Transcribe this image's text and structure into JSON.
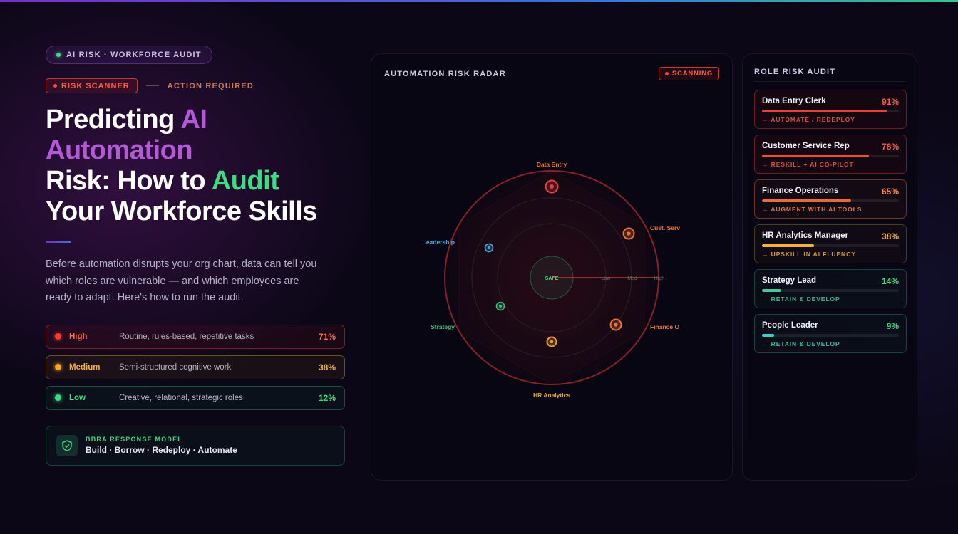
{
  "hero": {
    "pill": "AI RISK · WORKFORCE AUDIT",
    "scanner_tag": "RISK SCANNER",
    "action_label": "ACTION REQUIRED",
    "headline": {
      "part1": "Predicting ",
      "part2": "AI Automation",
      "part3": "Risk: How to ",
      "part4": "Audit",
      "part5": "Your Workforce Skills"
    },
    "description": "Before automation disrupts your org chart, data can tell you which roles are vulnerable — and which employees are ready to adapt. Here's how to run the audit."
  },
  "risk_levels": [
    {
      "level": "High",
      "description": "Routine, rules-based, repetitive tasks",
      "percent": "71%"
    },
    {
      "level": "Medium",
      "description": "Semi-structured cognitive work",
      "percent": "38%"
    },
    {
      "level": "Low",
      "description": "Creative, relational, strategic roles",
      "percent": "12%"
    }
  ],
  "bbra": {
    "label": "BBRA RESPONSE MODEL",
    "text": "Build · Borrow · Redeploy · Automate"
  },
  "radar": {
    "title": "AUTOMATION RISK RADAR",
    "badge": "SCANNING",
    "center_label": "SAFE",
    "scale_labels": [
      "Low",
      "Med",
      "High"
    ],
    "axes": [
      {
        "label": "Data Entry",
        "color": "#e8473a"
      },
      {
        "label": "Cust. Serv",
        "color": "#e8743a"
      },
      {
        "label": "Finance O",
        "color": "#e8743a"
      },
      {
        "label": "HR Analytics",
        "color": "#e8a030"
      },
      {
        "label": "Strategy",
        "color": "#3dbf78"
      },
      {
        "label": ".eadership",
        "color": "#4aa8e0"
      }
    ]
  },
  "audit": {
    "title": "ROLE RISK AUDIT",
    "roles": [
      {
        "name": "Data Entry Clerk",
        "percent": "91%",
        "level": 0.91,
        "action": "→ AUTOMATE / REDEPLOY",
        "bar_color": "#e8403a"
      },
      {
        "name": "Customer Service Rep",
        "percent": "78%",
        "level": 0.78,
        "action": "→ RESKILL + AI CO-PILOT",
        "bar_color": "#e8503a"
      },
      {
        "name": "Finance Operations",
        "percent": "65%",
        "level": 0.65,
        "action": "→ AUGMENT WITH AI TOOLS",
        "bar_color": "#ea6a3a"
      },
      {
        "name": "HR Analytics Manager",
        "percent": "38%",
        "level": 0.38,
        "action": "→ UPSKILL IN AI FLUENCY",
        "bar_color": "#f5b13a"
      },
      {
        "name": "Strategy Lead",
        "percent": "14%",
        "level": 0.14,
        "action": "→ RETAIN & DEVELOP",
        "bar_color": "#3dcc9a"
      },
      {
        "name": "People Leader",
        "percent": "9%",
        "level": 0.09,
        "action": "→ RETAIN & DEVELOP",
        "bar_color": "#3dcccc"
      }
    ]
  }
}
